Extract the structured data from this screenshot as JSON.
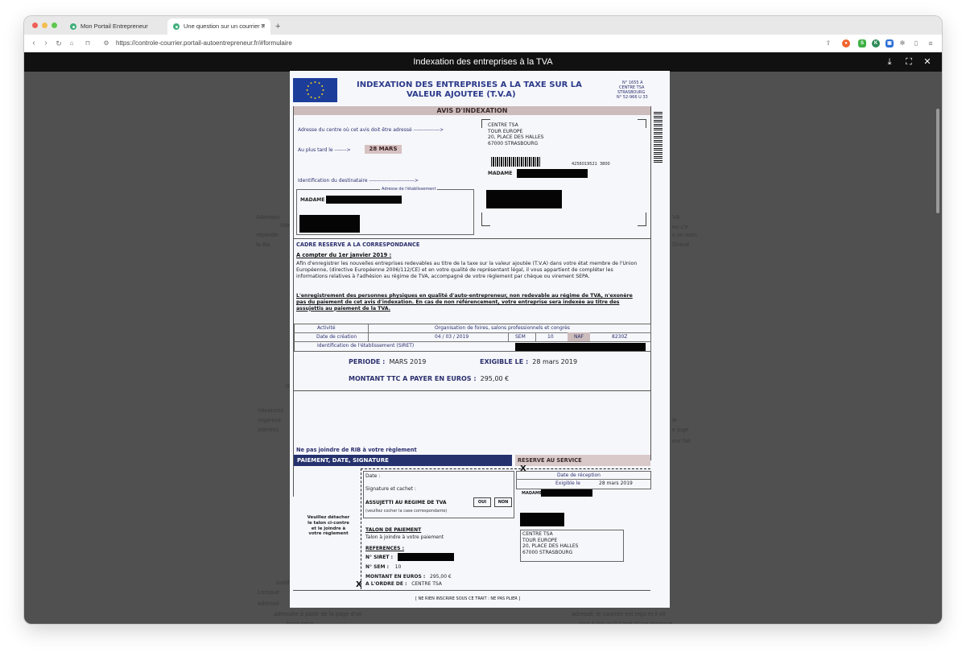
{
  "browser": {
    "tabs": [
      {
        "title": "Mon Portail Entrepreneur"
      },
      {
        "title": "Une question sur un courrier ?"
      }
    ],
    "new_tab_symbol": "+",
    "url": "https://controle-courrier.portail-autoentrepreneur.fr/#formulaire"
  },
  "viewer": {
    "title": "Indexation des entreprises à la TVA",
    "download_icon": "download-icon",
    "fullscreen_icon": "fullscreen-icon",
    "close_icon": "close-icon"
  },
  "document": {
    "header_title_1": "INDEXATION DES ENTREPRISES A LA TAXE SUR LA",
    "header_title_2": "VALEUR AJOUTEE (T.V.A)",
    "ref_1": "N° 1655 A",
    "ref_2": "CENTRE TSA",
    "ref_3": "STRASBOURG",
    "ref_4": "N° 52-966 U 33",
    "avis": "AVIS D'INDEXATION",
    "adresse_label": "Adresse du centre où cet avis doit être adressé",
    "adresse_arrow": "--------------->",
    "center_name": "CENTRE TSA",
    "center_line2": "TOUR EUROPE",
    "center_line3": "20, PLACE DES HALLES",
    "center_line4": "67000 STRASBOURG",
    "plus_tard_label": "Au plus tard le",
    "plus_tard_arrow": "------->",
    "plus_tard_date": "28 MARS",
    "barcode_number": "4256019521",
    "barcode_suffix": "3800",
    "madame": "MADAME",
    "identification_label": "Identification du destinataire",
    "identification_arrow": "-------------------------->",
    "etablissement_label": "Adresse de l'établissement",
    "cadre_title": "CADRE RESERVE A LA CORRESPONDANCE",
    "compter": "A compter du 1er janvier 2019 :",
    "para1": "Afin d'enregistrer les nouvelles entreprises redevables au titre de la taxe sur la valeur ajoutée (T.V.A) dans votre état membre de l'Union Européenne, (directive Européenne 2006/112/CE) et en votre qualité de représentant légal, il vous appartient de compléter les informations relatives à l'adhésion au régime de TVA, accompagné de votre règlement par chèque ou virement SEPA.",
    "para2": "L'enregistrement des personnes physiques en qualité d'auto-entrepreneur, non redevable au régime de TVA, n'exonère pas du paiement de cet avis d'indexation. En cas de non référencement, votre entreprise sera indexée au titre des assujettis au paiement de la TVA.",
    "activite_label": "Activité",
    "activite_value": "Organisation de foires, salons professionnels et congrès",
    "creation_label": "Date de création",
    "creation_value": "04 / 03 / 2019",
    "sem_label": "SEM",
    "sem_value": "10",
    "naf_label": "NAF",
    "naf_value": "8230Z",
    "siret_label": "Identification de l'établissement (SIRET)",
    "periode_label": "PERIODE :",
    "periode_value": "MARS 2019",
    "exigible_label": "EXIGIBLE LE :",
    "exigible_value": "28 mars 2019",
    "montant_label": "MONTANT TTC A PAYER EN EUROS :",
    "montant_value": "295,00 €",
    "rib_note": "Ne pas joindre de RIB à votre règlement",
    "paiement_title": "PAIEMENT, DATE, SIGNATURE",
    "reserve_title": "RESERVE AU SERVICE",
    "veuillez": "Veuillez détacher le talon ci-contre et le joindre à votre règlement",
    "date_label": "Date :",
    "signature_label": "Signature et cachet :",
    "assujetti": "ASSUJETTI AU REGIME DE TVA",
    "oui": "OUI",
    "non": "NON",
    "cocher": "(veuillez cocher la case correspondante)",
    "date_reception": "Date de réception",
    "exigible_le": "Exigible le",
    "exigible_date": "28 mars 2019",
    "talon_title": "TALON DE PAIEMENT",
    "talon_sub": "Talon à joindre à votre paiement",
    "references": "REFERENCES :",
    "no_siret": "N° SIRET :",
    "no_sem_label": "N° SEM :",
    "no_sem_value": "10",
    "montant_euros_label": "MONTANT EN EUROS :",
    "montant_euros_value": "295,00 €",
    "ordre_label": "A L'ORDRE DE :",
    "ordre_value": "CENTRE TSA",
    "footer": "[ NE RIEN INSCRIRE SOUS CE TRAIT : NE PAS PLIER ]",
    "cut_mark": "X"
  },
  "colors": {
    "tab_accent": "#3fae7a",
    "viewer_bg": "#505050",
    "doc_ink": "#2b2f6d",
    "band": "#cdbcbc",
    "eu_blue": "#1d3d9a",
    "eu_yellow": "#f2d31b"
  }
}
